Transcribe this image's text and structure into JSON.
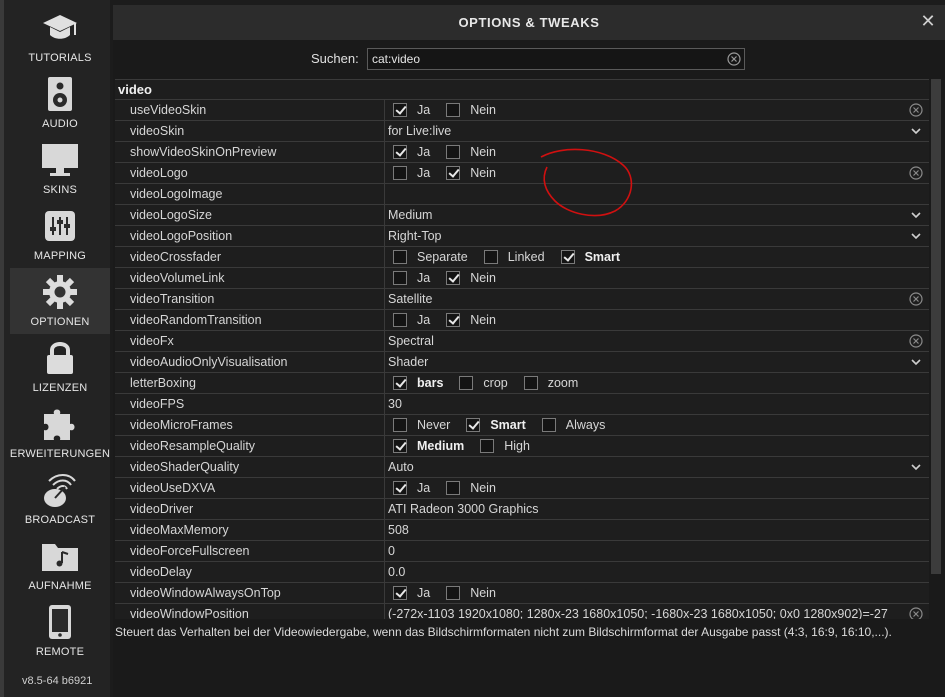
{
  "sidebar": {
    "items": [
      {
        "label": "TUTORIALS",
        "icon": "graduation-cap-icon",
        "active": false
      },
      {
        "label": "AUDIO",
        "icon": "speaker-icon",
        "active": false
      },
      {
        "label": "SKINS",
        "icon": "monitor-icon",
        "active": false
      },
      {
        "label": "MAPPING",
        "icon": "sliders-icon",
        "active": false
      },
      {
        "label": "OPTIONEN",
        "icon": "gear-icon",
        "active": true
      },
      {
        "label": "LIZENZEN",
        "icon": "lock-icon",
        "active": false
      },
      {
        "label": "ERWEITERUNGEN",
        "icon": "puzzle-icon",
        "active": false
      },
      {
        "label": "BROADCAST",
        "icon": "broadcast-icon",
        "active": false
      },
      {
        "label": "AUFNAHME",
        "icon": "music-folder-icon",
        "active": false
      },
      {
        "label": "REMOTE",
        "icon": "phone-icon",
        "active": false
      }
    ],
    "version": "v8.5-64 b6921"
  },
  "dialog": {
    "title": "OPTIONS & TWEAKS",
    "search_label": "Suchen:",
    "search_value": "cat:video",
    "section": "video",
    "description": "Steuert das Verhalten bei der Videowiedergabe, wenn das Bildschirmformaten nicht zum Bildschirmformat der Ausgabe passt (4:3, 16:9, 16:10,...)."
  },
  "rows": [
    {
      "name": "useVideoSkin",
      "type": "checks",
      "options": [
        {
          "label": "Ja",
          "checked": true
        },
        {
          "label": "Nein",
          "checked": false
        }
      ],
      "icon": "clear"
    },
    {
      "name": "videoSkin",
      "type": "select",
      "value": "for Live:live"
    },
    {
      "name": "showVideoSkinOnPreview",
      "type": "checks",
      "options": [
        {
          "label": "Ja",
          "checked": true
        },
        {
          "label": "Nein",
          "checked": false
        }
      ]
    },
    {
      "name": "videoLogo",
      "type": "checks",
      "options": [
        {
          "label": "Ja",
          "checked": false
        },
        {
          "label": "Nein",
          "checked": true
        }
      ],
      "icon": "clear"
    },
    {
      "name": "videoLogoImage",
      "type": "text",
      "value": ""
    },
    {
      "name": "videoLogoSize",
      "type": "select",
      "value": "Medium"
    },
    {
      "name": "videoLogoPosition",
      "type": "select",
      "value": "Right-Top"
    },
    {
      "name": "videoCrossfader",
      "type": "checks",
      "options": [
        {
          "label": "Separate",
          "checked": false
        },
        {
          "label": "Linked",
          "checked": false
        },
        {
          "label": "Smart",
          "checked": true,
          "bold": true
        }
      ]
    },
    {
      "name": "videoVolumeLink",
      "type": "checks",
      "options": [
        {
          "label": "Ja",
          "checked": false
        },
        {
          "label": "Nein",
          "checked": true
        }
      ]
    },
    {
      "name": "videoTransition",
      "type": "text",
      "value": "Satellite",
      "icon": "clear"
    },
    {
      "name": "videoRandomTransition",
      "type": "checks",
      "options": [
        {
          "label": "Ja",
          "checked": false
        },
        {
          "label": "Nein",
          "checked": true
        }
      ]
    },
    {
      "name": "videoFx",
      "type": "text",
      "value": "Spectral",
      "icon": "clear"
    },
    {
      "name": "videoAudioOnlyVisualisation",
      "type": "select",
      "value": "Shader"
    },
    {
      "name": "letterBoxing",
      "type": "checks",
      "options": [
        {
          "label": "bars",
          "checked": true,
          "bold": true
        },
        {
          "label": "crop",
          "checked": false
        },
        {
          "label": "zoom",
          "checked": false
        }
      ]
    },
    {
      "name": "videoFPS",
      "type": "text",
      "value": "30"
    },
    {
      "name": "videoMicroFrames",
      "type": "checks",
      "options": [
        {
          "label": "Never",
          "checked": false
        },
        {
          "label": "Smart",
          "checked": true,
          "bold": true
        },
        {
          "label": "Always",
          "checked": false
        }
      ]
    },
    {
      "name": "videoResampleQuality",
      "type": "checks",
      "options": [
        {
          "label": "Medium",
          "checked": true,
          "bold": true
        },
        {
          "label": "High",
          "checked": false
        }
      ]
    },
    {
      "name": "videoShaderQuality",
      "type": "select",
      "value": "Auto"
    },
    {
      "name": "videoUseDXVA",
      "type": "checks",
      "options": [
        {
          "label": "Ja",
          "checked": true
        },
        {
          "label": "Nein",
          "checked": false
        }
      ]
    },
    {
      "name": "videoDriver",
      "type": "text",
      "value": "ATI Radeon 3000 Graphics"
    },
    {
      "name": "videoMaxMemory",
      "type": "text",
      "value": "508"
    },
    {
      "name": "videoForceFullscreen",
      "type": "text",
      "value": "0"
    },
    {
      "name": "videoDelay",
      "type": "text",
      "value": "0.0"
    },
    {
      "name": "videoWindowAlwaysOnTop",
      "type": "checks",
      "options": [
        {
          "label": "Ja",
          "checked": true
        },
        {
          "label": "Nein",
          "checked": false
        }
      ]
    },
    {
      "name": "videoWindowPosition",
      "type": "text",
      "value": "(-272x-1103 1920x1080; 1280x-23 1680x1050; -1680x-23 1680x1050; 0x0 1280x902)=-27",
      "icon": "clear"
    }
  ],
  "colors": {
    "annotation": "#d01010",
    "background": "#1c1c1c",
    "sidebar": "#232323"
  }
}
